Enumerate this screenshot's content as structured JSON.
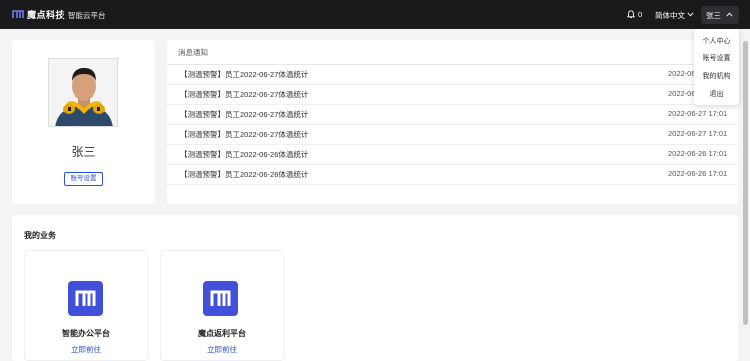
{
  "header": {
    "brand": "魔点科技",
    "platform": "智能云平台",
    "notification_count": "0",
    "language": "简体中文",
    "user_name": "张三"
  },
  "user_menu": {
    "items": [
      "个人中心",
      "账号设置",
      "我的机构",
      "退出"
    ]
  },
  "profile": {
    "name": "张三",
    "account_button": "账号设置"
  },
  "notices": {
    "title": "消息通知",
    "rows": [
      {
        "text": "【测温预警】员工2022-06-27体温统计",
        "time": "2022-06-27 17:01"
      },
      {
        "text": "【测温预警】员工2022-06-27体温统计",
        "time": "2022-06-27 17:01"
      },
      {
        "text": "【测温预警】员工2022-06-27体温统计",
        "time": "2022-06-27 17:01"
      },
      {
        "text": "【测温预警】员工2022-06-27体温统计",
        "time": "2022-06-27 17:01"
      },
      {
        "text": "【测温预警】员工2022-06-26体温统计",
        "time": "2022-06-26 17:01"
      },
      {
        "text": "【测温预警】员工2022-06-26体温统计",
        "time": "2022-06-26 17:01"
      }
    ]
  },
  "business": {
    "title": "我的业务",
    "tiles": [
      {
        "name": "智能办公平台",
        "link": "立即前往",
        "icon": "modian-logo-icon"
      },
      {
        "name": "魔点返利平台",
        "link": "立即前往",
        "icon": "modian-logo-icon"
      }
    ]
  },
  "colors": {
    "topbar": "#1a1a1c",
    "accent": "#2b4fd6",
    "tile_icon": "#4150d8"
  }
}
